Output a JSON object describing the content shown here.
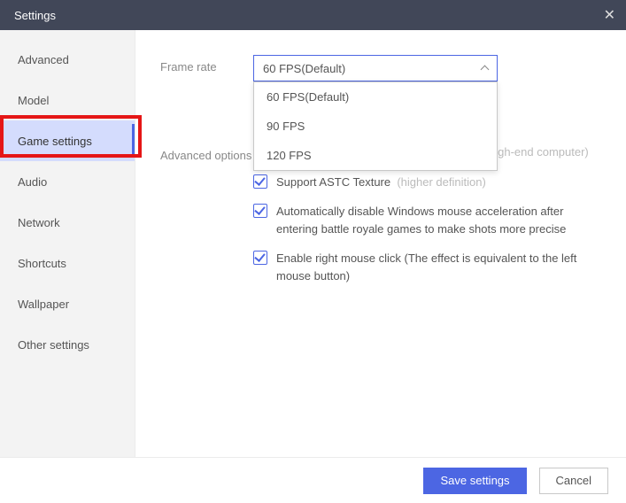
{
  "window": {
    "title": "Settings"
  },
  "sidebar": {
    "items": [
      {
        "label": "Advanced",
        "active": false
      },
      {
        "label": "Model",
        "active": false
      },
      {
        "label": "Game settings",
        "active": true
      },
      {
        "label": "Audio",
        "active": false
      },
      {
        "label": "Network",
        "active": false
      },
      {
        "label": "Shortcuts",
        "active": false
      },
      {
        "label": "Wallpaper",
        "active": false
      },
      {
        "label": "Other settings",
        "active": false
      }
    ]
  },
  "content": {
    "frame_rate": {
      "label": "Frame rate",
      "selected": "60 FPS(Default)",
      "options": [
        "60 FPS(Default)",
        "90 FPS",
        "120 FPS"
      ]
    },
    "advanced_options": {
      "label": "Advanced options",
      "items": [
        {
          "text_fragment_visible": "g",
          "hint": "(suitable for high-end computer)",
          "checked": true
        },
        {
          "text": "Support ASTC Texture",
          "hint": "(higher definition)",
          "checked": true
        },
        {
          "text": "Automatically disable Windows mouse acceleration after entering battle royale games to make shots more precise",
          "checked": true
        },
        {
          "text": "Enable right mouse click (The effect is equivalent to the left mouse button)",
          "checked": true
        }
      ]
    }
  },
  "footer": {
    "save": "Save settings",
    "cancel": "Cancel"
  }
}
